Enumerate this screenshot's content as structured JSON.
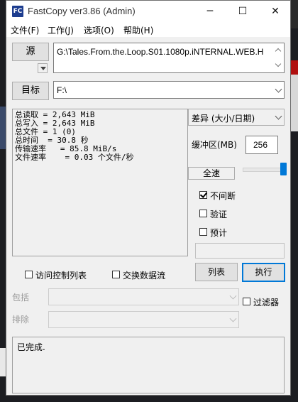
{
  "window": {
    "title": "FastCopy ver3.86 (Admin)",
    "app_icon_text": "FC",
    "minimize": "─",
    "maximize": "☐",
    "close": "✕"
  },
  "menu": {
    "items": [
      "文件(F)",
      "工作(J)",
      "选项(O)",
      "帮助(H)"
    ]
  },
  "source": {
    "button_label": "源",
    "path": "G:\\Tales.From.the.Loop.S01.1080p.iNTERNAL.WEB.H"
  },
  "destination": {
    "button_label": "目标",
    "path": "F:\\"
  },
  "stats": [
    "总读取 = 2,643 MiB",
    "总写入 = 2,643 MiB",
    "总文件 = 1 (0)",
    "总时间  = 30.8 秒",
    "传输速率   = 85.8 MiB/s",
    "文件速率    = 0.03 个文件/秒"
  ],
  "mode": {
    "selected": "差异 (大小/日期)"
  },
  "buffer": {
    "label": "缓冲区(MB)",
    "value": "256"
  },
  "speed": {
    "label": "全速",
    "level": 1.0
  },
  "options": {
    "nonstop": {
      "label": "不间断",
      "checked": true
    },
    "verify": {
      "label": "验证",
      "checked": false
    },
    "estimate": {
      "label": "预计",
      "checked": false
    }
  },
  "acl": {
    "label": "访问控制列表",
    "checked": false
  },
  "streams": {
    "label": "交换数据流",
    "checked": false
  },
  "actions": {
    "list_label": "列表",
    "execute_label": "执行"
  },
  "filters": {
    "include_label": "包括",
    "exclude_label": "排除",
    "filter_label": "过滤器",
    "filter_checked": false
  },
  "status": {
    "text": "已完成."
  }
}
